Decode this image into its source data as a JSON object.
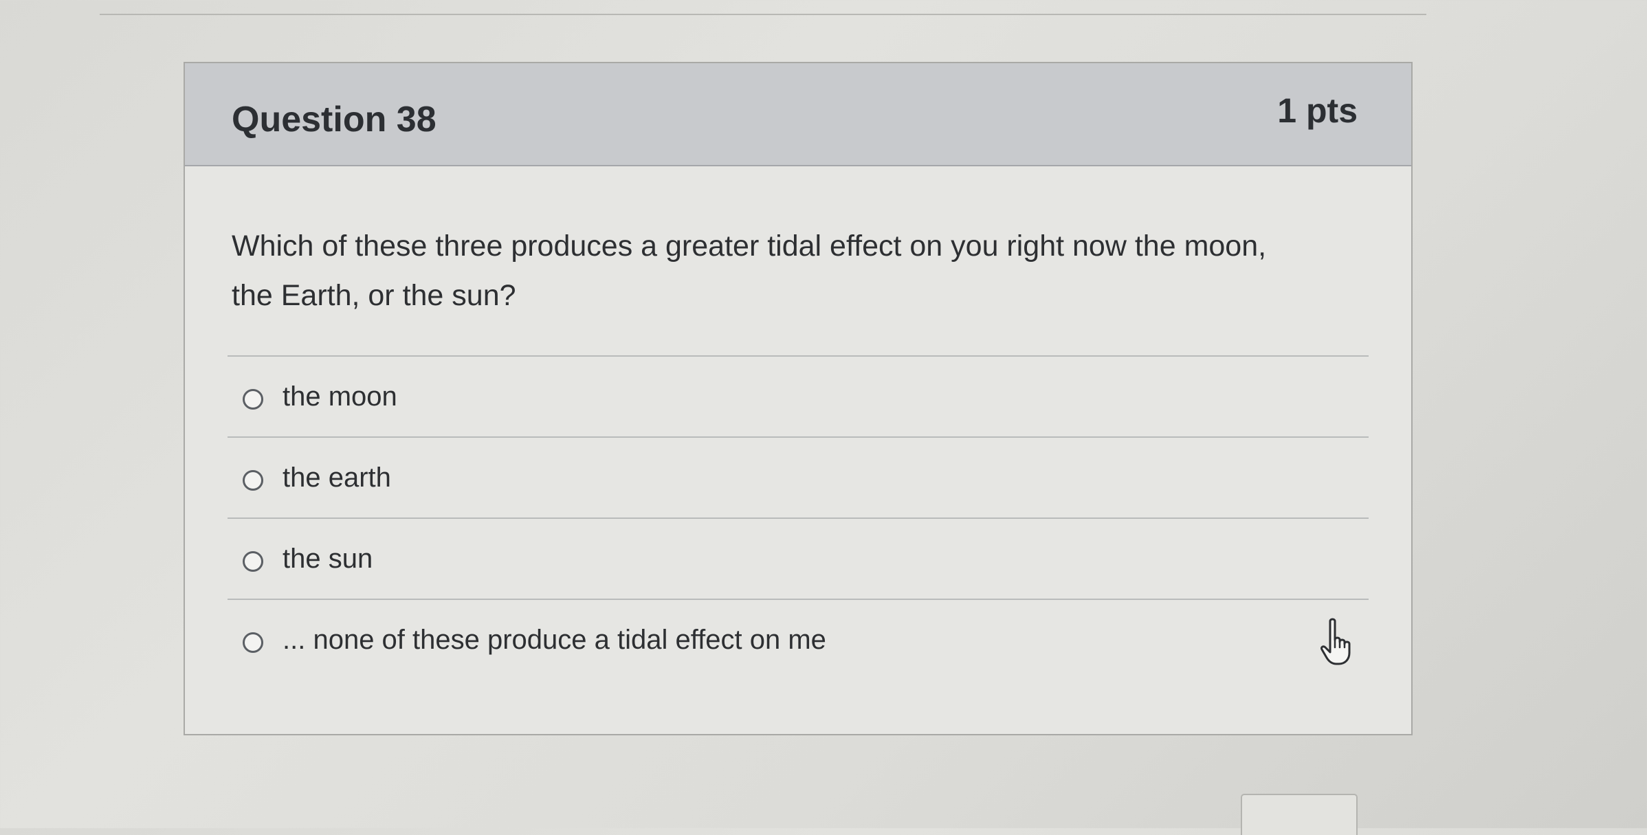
{
  "question": {
    "title": "Question 38",
    "points": "1 pts",
    "text": "Which of these three produces a greater tidal effect on you right now the moon, the Earth, or the sun?"
  },
  "answers": [
    {
      "label": "the moon",
      "selected": false
    },
    {
      "label": "the earth",
      "selected": false
    },
    {
      "label": "the sun",
      "selected": false
    },
    {
      "label": "... none of these produce a tidal effect on me",
      "selected": false
    }
  ],
  "icons": {
    "radio": "radio-button-empty-icon",
    "cursor": "hand-pointer-icon"
  },
  "colors": {
    "header_bg": "#c8cacd",
    "card_bg": "#e6e6e3",
    "text": "#2d2f32"
  }
}
